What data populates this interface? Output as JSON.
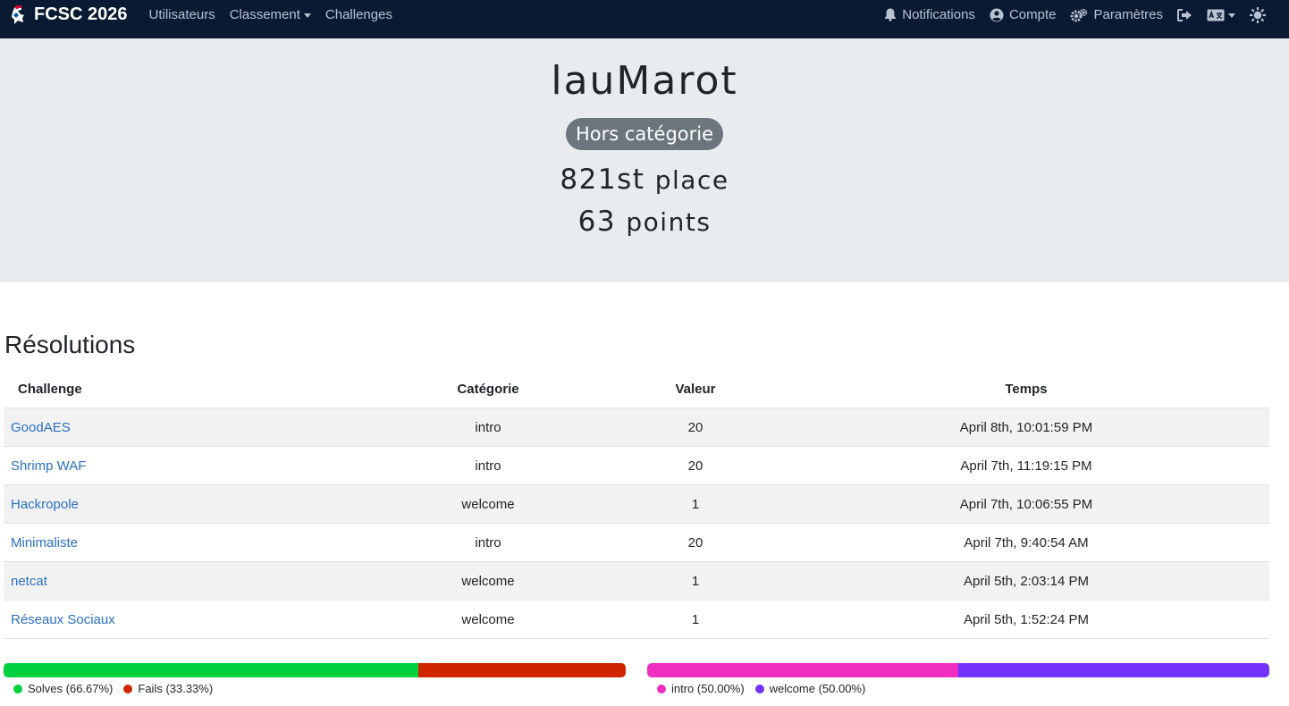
{
  "navbar": {
    "brand": "FCSC 2026",
    "left_items": [
      "Utilisateurs",
      "Classement",
      "Challenges"
    ],
    "notifications": "Notifications",
    "account": "Compte",
    "settings": "Paramètres"
  },
  "profile": {
    "username": "lauMarot",
    "badge": "Hors catégorie",
    "place_number": "821st",
    "place_word": "place",
    "points_number": "63",
    "points_word": "points"
  },
  "solves": {
    "title": "Résolutions",
    "headers": [
      "Challenge",
      "Catégorie",
      "Valeur",
      "Temps"
    ],
    "rows": [
      {
        "challenge": "GoodAES",
        "category": "intro",
        "value": "20",
        "time": "April 8th, 10:01:59 PM"
      },
      {
        "challenge": "Shrimp WAF",
        "category": "intro",
        "value": "20",
        "time": "April 7th, 11:19:15 PM"
      },
      {
        "challenge": "Hackropole",
        "category": "welcome",
        "value": "1",
        "time": "April 7th, 10:06:55 PM"
      },
      {
        "challenge": "Minimaliste",
        "category": "intro",
        "value": "20",
        "time": "April 7th, 9:40:54 AM"
      },
      {
        "challenge": "netcat",
        "category": "welcome",
        "value": "1",
        "time": "April 5th, 2:03:14 PM"
      },
      {
        "challenge": "Réseaux Sociaux",
        "category": "welcome",
        "value": "1",
        "time": "April 5th, 1:52:24 PM"
      }
    ]
  },
  "chart_data": [
    {
      "type": "bar",
      "series": [
        {
          "name": "Solves",
          "value": 66.67,
          "label": "Solves (66.67%)",
          "color": "#00d13f"
        },
        {
          "name": "Fails",
          "value": 33.33,
          "label": "Fails (33.33%)",
          "color": "#cf2600"
        }
      ]
    },
    {
      "type": "bar",
      "series": [
        {
          "name": "intro",
          "value": 50.0,
          "label": "intro (50.00%)",
          "color": "#f02fc2"
        },
        {
          "name": "welcome",
          "value": 50.0,
          "label": "welcome (50.00%)",
          "color": "#7532fa"
        }
      ]
    }
  ]
}
